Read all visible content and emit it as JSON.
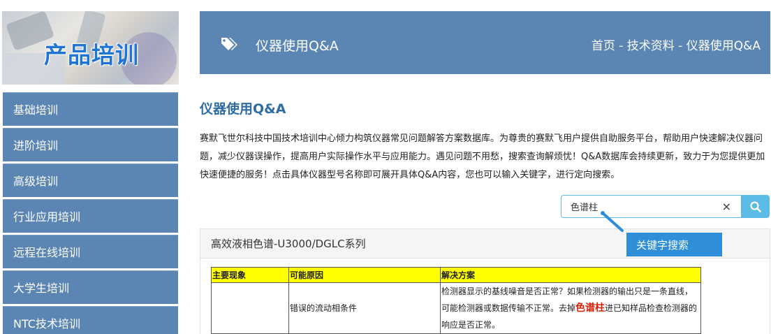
{
  "banner": {
    "title": "产品培训"
  },
  "sidebar": {
    "items": [
      {
        "label": "基础培训"
      },
      {
        "label": "进阶培训"
      },
      {
        "label": "高级培训"
      },
      {
        "label": "行业应用培训"
      },
      {
        "label": "远程在线培训"
      },
      {
        "label": "大学生培训"
      },
      {
        "label": "NTC技术培训"
      }
    ]
  },
  "header": {
    "title": "仪器使用Q&A",
    "breadcrumb": "首页 - 技术资料 - 仪器使用Q&A",
    "icon": "tags-icon"
  },
  "main": {
    "page_title": "仪器使用Q&A",
    "intro": "赛默飞世尔科技中国技术培训中心倾力构筑仪器常见问题解答方案数据库。为尊贵的赛默飞用户提供自助服务平台，帮助用户快速解决仪器问题，减少仪器误操作，提高用户实际操作水平与应用能力。遇见问题不用愁，搜索查询解烦忧！Q&A数据库会持续更新，致力于为您提供更加快速便捷的服务！点击具体仪器型号名称即可展开具体Q&A内容，您也可以输入关键字，进行定向搜索。"
  },
  "search": {
    "value": "色谱柱",
    "clear_glyph": "×",
    "tooltip": "关键字搜索"
  },
  "panel": {
    "title": "高效液相色谱-U3000/DGLC系列",
    "table": {
      "headers": [
        "主要现象",
        "可能原因",
        "解决方案"
      ],
      "row": {
        "symptom": "",
        "cause": "错误的流动相条件",
        "solution_before": "检测器显示的基线噪音是否正常？如果检测器的输出只是一条直线，可能检测器或数据传输不正常。去掉",
        "solution_highlight": "色谱柱",
        "solution_after": "进已知样品检查检测器的响应是否正常。"
      }
    }
  },
  "colors": {
    "nav": "#5b86b4",
    "accent": "#5bbbe6",
    "tooltip": "#2e8fd8",
    "table_header": "#ffff00",
    "highlight": "#d81e06"
  }
}
